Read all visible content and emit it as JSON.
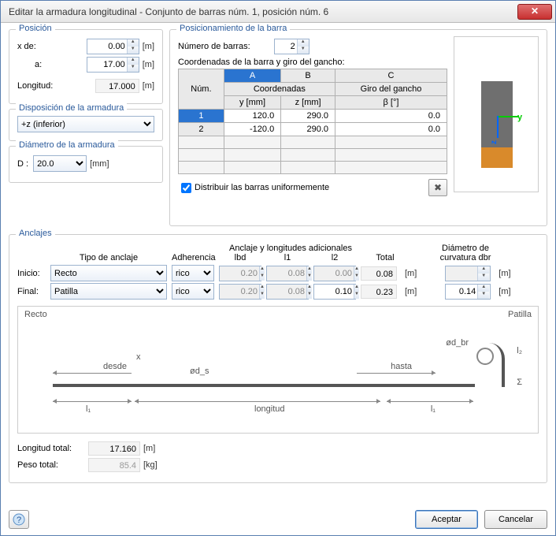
{
  "window": {
    "title": "Editar la armadura longitudinal - Conjunto de barras núm. 1, posición núm. 6",
    "close": "✕"
  },
  "posicion": {
    "legend": "Posición",
    "x_de_label": "x  de:",
    "x_de_value": "0.00",
    "a_label": "a:",
    "a_value": "17.00",
    "longitud_label": "Longitud:",
    "longitud_value": "17.000",
    "unit_m": "[m]"
  },
  "disposicion": {
    "legend": "Disposición de la armadura",
    "selected": "+z (inferior)"
  },
  "diametro": {
    "legend": "Diámetro de la armadura",
    "d_label": "D :",
    "selected": "20.0",
    "unit": "[mm]"
  },
  "posbarra": {
    "legend": "Posicionamiento de la barra",
    "num_barras_label": "Número de barras:",
    "num_barras_value": "2",
    "coord_label": "Coordenadas de la barra y giro del gancho:",
    "col_letters": [
      "A",
      "B",
      "C"
    ],
    "headers": {
      "num": "Núm.",
      "coord": "Coordenadas",
      "y": "y [mm]",
      "z": "z [mm]",
      "giro": "Giro del gancho",
      "beta": "β [°]"
    },
    "rows": [
      {
        "n": "1",
        "y": "120.0",
        "z": "290.0",
        "b": "0.0"
      },
      {
        "n": "2",
        "y": "-120.0",
        "z": "290.0",
        "b": "0.0"
      }
    ],
    "distribuir": "Distribuir las barras uniformemente",
    "ylab": "y",
    "zlab": "z"
  },
  "anclajes": {
    "legend": "Anclajes",
    "hdr_tipo": "Tipo de anclaje",
    "hdr_adh": "Adherencia",
    "hdr_add": "Anclaje y longitudes adicionales",
    "hdr_lbd": "lbd",
    "hdr_l1": "l1",
    "hdr_l2": "l2",
    "hdr_total": "Total",
    "hdr_dbr": "Diámetro de curvatura dbr",
    "inicio_label": "Inicio:",
    "final_label": "Final:",
    "inicio": {
      "tipo": "Recto",
      "adh": "rico",
      "lbd": "0.20",
      "l1": "0.08",
      "l2": "0.00",
      "total": "0.08",
      "dbr": ""
    },
    "final": {
      "tipo": "Patilla",
      "adh": "rico",
      "lbd": "0.20",
      "l1": "0.08",
      "l2": "0.10",
      "total": "0.23",
      "dbr": "0.14"
    },
    "unit_m": "[m]",
    "diag_recto": "Recto",
    "diag_patilla": "Patilla",
    "diag_desde": "desde",
    "diag_hasta": "hasta",
    "diag_longitud": "longitud",
    "diag_l1": "l₁",
    "diag_ds": "ød_s",
    "diag_dbr": "ød_br",
    "diag_l2": "l₂",
    "diag_sigma": "Σ",
    "diag_x": "x",
    "longitud_total_label": "Longitud total:",
    "longitud_total_value": "17.160",
    "peso_label": "Peso total:",
    "peso_value": "85.4",
    "unit_kg": "[kg]"
  },
  "footer": {
    "help": "?",
    "ok": "Aceptar",
    "cancel": "Cancelar"
  }
}
